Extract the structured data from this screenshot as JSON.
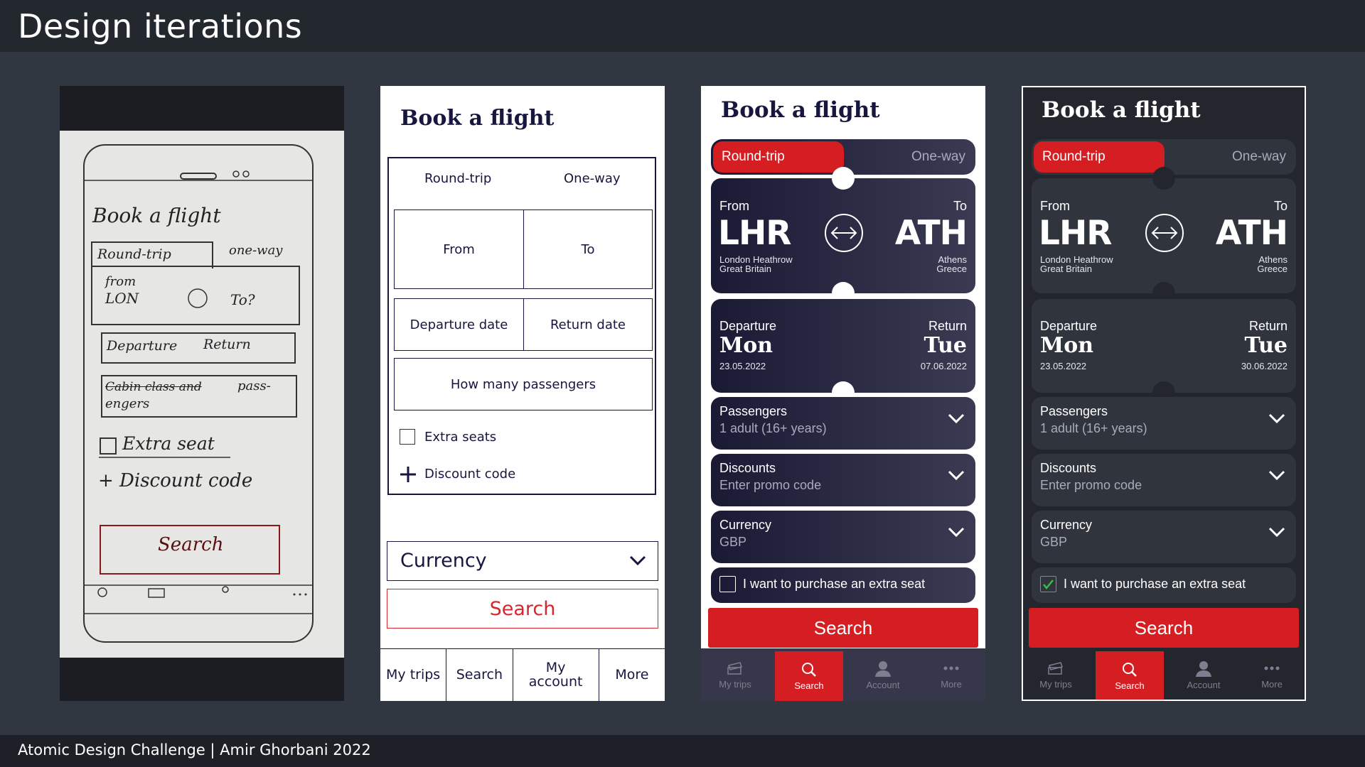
{
  "header": {
    "title": "Design iterations"
  },
  "footer": {
    "credit": "Atomic Design Challenge | Amir Ghorbani 2022"
  },
  "sketch": {
    "title": "Book a flight",
    "round_trip": "Round-trip",
    "one_way": "one-way",
    "from": "from",
    "from_code": "LON",
    "to": "To?",
    "departure": "Departure",
    "return": "Return",
    "cabin_struck": "Cabin class and",
    "passengers_1": "pass-",
    "passengers_2": "engers",
    "extra_seat": "Extra seat",
    "discount": "+ Discount code",
    "search": "Search"
  },
  "wireframe": {
    "title": "Book a flight",
    "round_trip": "Round-trip",
    "one_way": "One-way",
    "from": "From",
    "to": "To",
    "departure": "Departure date",
    "return": "Return date",
    "passengers": "How many passengers",
    "extra_seats": "Extra seats",
    "discount": "Discount code",
    "currency": "Currency",
    "search": "Search",
    "nav": [
      "My trips",
      "Search",
      "My account",
      "More"
    ]
  },
  "hifi": {
    "title": "Book a flight",
    "round_trip": "Round-trip",
    "one_way": "One-way",
    "from_label": "From",
    "to_label": "To",
    "from_code": "LHR",
    "to_code": "ATH",
    "from_airport": "London Heathrow",
    "from_country": "Great Britain",
    "to_city": "Athens",
    "to_country": "Greece",
    "departure_label": "Departure",
    "return_label": "Return",
    "dep_day": "Mon",
    "ret_day": "Tue",
    "dep_date": "23.05.2022",
    "passengers_label": "Passengers",
    "passengers_value": "1 adult (16+ years)",
    "discounts_label": "Discounts",
    "discounts_value": "Enter promo code",
    "currency_label": "Currency",
    "currency_value": "GBP",
    "extra_seat": "I want to purchase an extra seat",
    "search": "Search",
    "tabs": [
      "My trips",
      "Search",
      "Account",
      "More"
    ],
    "accent_color": "#d51e22"
  },
  "light_variant": {
    "ret_date": "07.06.2022",
    "extra_seat_checked": false
  },
  "dark_variant": {
    "ret_date": "30.06.2022",
    "extra_seat_checked": true
  }
}
